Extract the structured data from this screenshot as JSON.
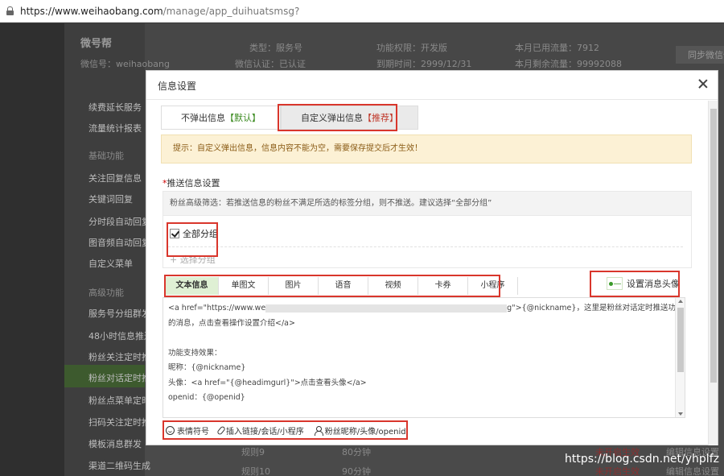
{
  "browser": {
    "url_host": "https://www.weihaobang.com",
    "url_path": "/manage/app_duihuatsmsg?"
  },
  "background": {
    "brand": "微号帮",
    "wechat_id": "微信号：weihaobang",
    "meta": [
      "类型：服务号",
      "功能权限：开发版",
      "本月已用流量：7912",
      "微信认证：已认证",
      "到期时间：2999/12/31",
      "本月剩余流量：99992088"
    ],
    "sync_button": "同步微信信息",
    "sidebar": [
      "续费延长服务",
      "流量统计报表",
      "基础功能",
      "关注回复信息",
      "关键词回复",
      "分时段自动回复",
      "图音频自动回复",
      "自定义菜单",
      "高级功能",
      "服务号分组群发",
      "48小时信息推送",
      "粉丝关注定时推送",
      "粉丝对话定时推送",
      "粉丝点菜单定时推送",
      "扫码关注定时推送",
      "模板消息群发",
      "渠道二维码生成"
    ],
    "rows": [
      {
        "name": "规则9",
        "time": "80分钟",
        "status": "未开启生效",
        "action": "编辑信息设置"
      },
      {
        "name": "规则10",
        "time": "90分钟",
        "status": "未开启生效",
        "action": "编辑信息设置"
      }
    ]
  },
  "modal": {
    "title": "信息设置",
    "tabs": [
      {
        "label": "不弹出信息",
        "badge": "【默认】"
      },
      {
        "label": "自定义弹出信息",
        "badge": "【推荐】"
      }
    ],
    "tip": "提示：自定义弹出信息，信息内容不能为空，需要保存提交后才生效！",
    "section_title": "推送信息设置",
    "section_star": "*",
    "filter_text": "粉丝高级筛选：若推送信息的粉丝不满足所选的标签分组，则不推送。建议选择“全部分组”",
    "checkbox_label": "全部分组",
    "add_group": "+ 选择分组",
    "content_tabs": [
      "文本信息",
      "单图文",
      "图片",
      "语音",
      "视频",
      "卡券",
      "小程序"
    ],
    "avatar_button": "设置消息头像",
    "editor_lines": [
      "<a href=\"https://www.we",
      "g\">{@nickname}，这里是粉丝对话定时推送功能推送",
      "的消息，点击查看操作设置介绍</a>",
      "",
      "功能支持效果：",
      "昵称：{@nickname}",
      "头像：<a href=\"{@headimgurl}\">点击查看头像</a>",
      "openid：{@openid}"
    ],
    "toolbar": [
      "表情符号",
      "插入链接/会话/小程序",
      "粉丝昵称/头像/openid"
    ]
  },
  "watermark": "https://blog.csdn.net/yhplfz",
  "colors": {
    "highlight_red": "#d9362c",
    "active_tab_green": "#dff0d4",
    "tip_bg": "#fcf1d5"
  }
}
